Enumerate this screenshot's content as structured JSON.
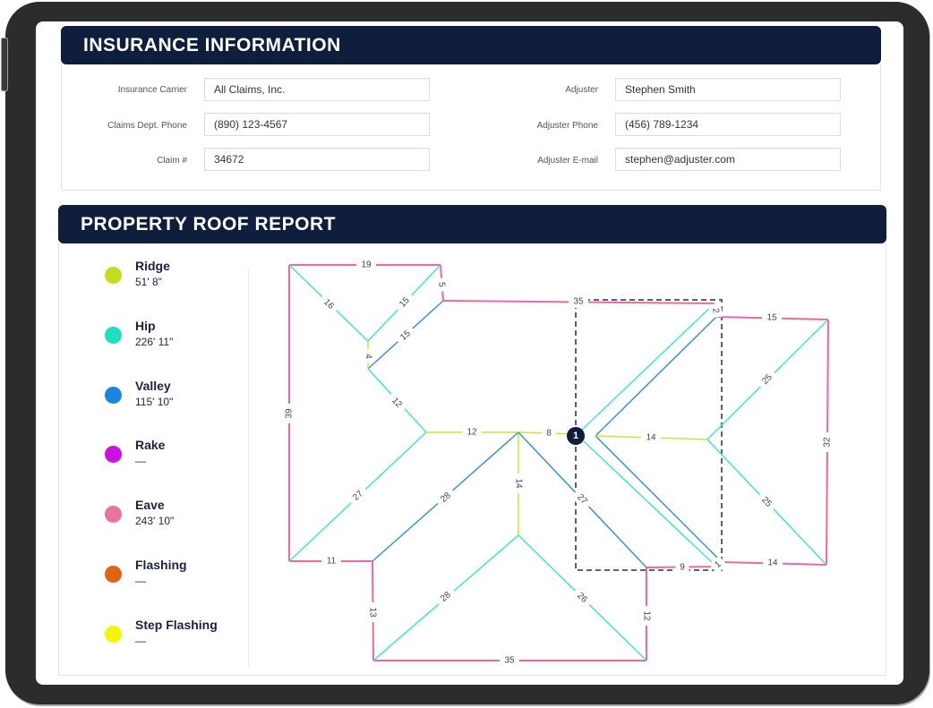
{
  "insurance": {
    "title": "INSURANCE INFORMATION",
    "left_fields": [
      {
        "label": "Insurance Carrier",
        "value": "All Claims, Inc."
      },
      {
        "label": "Claims Dept. Phone",
        "value": "(890) 123-4567"
      },
      {
        "label": "Claim #",
        "value": "34672"
      }
    ],
    "right_fields": [
      {
        "label": "Adjuster",
        "value": "Stephen Smith"
      },
      {
        "label": "Adjuster Phone",
        "value": "(456) 789-1234"
      },
      {
        "label": "Adjuster E-mail",
        "value": "stephen@adjuster.com"
      }
    ]
  },
  "roof_report": {
    "title": "PROPERTY ROOF REPORT",
    "legend": [
      {
        "key": "ridge",
        "name": "Ridge",
        "value": "51' 8\"",
        "color": "#c5dc1e"
      },
      {
        "key": "hip",
        "name": "Hip",
        "value": "226' 11\"",
        "color": "#1de0c3"
      },
      {
        "key": "valley",
        "name": "Valley",
        "value": "115' 10\"",
        "color": "#1a86e0"
      },
      {
        "key": "rake",
        "name": "Rake",
        "value": "—",
        "color": "#cc10e0"
      },
      {
        "key": "eave",
        "name": "Eave",
        "value": "243' 10\"",
        "color": "#e8739f"
      },
      {
        "key": "flashing",
        "name": "Flashing",
        "value": "—",
        "color": "#e0640f"
      },
      {
        "key": "step_flashing",
        "name": "Step Flashing",
        "value": "—",
        "color": "#f5f50a"
      }
    ],
    "diagram": {
      "line_colors": {
        "eave": "#f0679f",
        "hip": "#3ee6cc",
        "valley": "#3a8ee0",
        "ridge": "#cfe33a"
      },
      "marker_label": "1",
      "marker_color": "#0f1e3c",
      "segments": [
        {
          "type": "eave",
          "length": "19"
        },
        {
          "type": "eave",
          "length": "5"
        },
        {
          "type": "eave",
          "length": "35"
        },
        {
          "type": "eave",
          "length": "2"
        },
        {
          "type": "eave",
          "length": "15"
        },
        {
          "type": "eave",
          "length": "32"
        },
        {
          "type": "eave",
          "length": "14"
        },
        {
          "type": "eave",
          "length": "1"
        },
        {
          "type": "eave",
          "length": "9"
        },
        {
          "type": "eave",
          "length": "12"
        },
        {
          "type": "eave",
          "length": "35"
        },
        {
          "type": "eave",
          "length": "13"
        },
        {
          "type": "eave",
          "length": "11"
        },
        {
          "type": "eave",
          "length": "39"
        },
        {
          "type": "hip",
          "length": "16"
        },
        {
          "type": "hip",
          "length": "15"
        },
        {
          "type": "valley",
          "length": "15"
        },
        {
          "type": "ridge",
          "length": "4"
        },
        {
          "type": "hip",
          "length": "12"
        },
        {
          "type": "ridge",
          "length": "12"
        },
        {
          "type": "ridge",
          "length": "8"
        },
        {
          "type": "hip",
          "length": "27"
        },
        {
          "type": "valley",
          "length": "28"
        },
        {
          "type": "ridge",
          "length": "14"
        },
        {
          "type": "valley",
          "length": "27"
        },
        {
          "type": "hip",
          "length": "28"
        },
        {
          "type": "hip",
          "length": "26"
        },
        {
          "type": "hip",
          "length": ""
        },
        {
          "type": "valley",
          "length": ""
        },
        {
          "type": "hip",
          "length": ""
        },
        {
          "type": "valley",
          "length": ""
        },
        {
          "type": "ridge",
          "length": "14"
        },
        {
          "type": "hip",
          "length": "25"
        },
        {
          "type": "hip",
          "length": "25"
        }
      ]
    }
  }
}
